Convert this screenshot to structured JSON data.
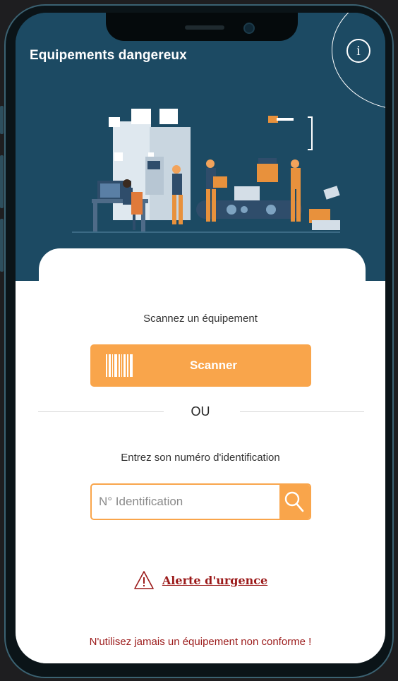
{
  "app": {
    "title": "Equipements dangereux",
    "info_button_label": "i"
  },
  "scan": {
    "prompt": "Scannez un équipement",
    "button_label": "Scanner"
  },
  "or_label": "OU",
  "identification": {
    "prompt": "Entrez son numéro d'identification",
    "placeholder": "N° Identification",
    "value": ""
  },
  "alert": {
    "label": "Alerte d'urgence"
  },
  "footer": {
    "warning": "N'utilisez jamais un équipement non conforme !"
  },
  "colors": {
    "header_bg": "#1c4a63",
    "accent": "#f9a54b",
    "alert_red": "#9b1a1a"
  },
  "icons": {
    "info": "info-icon",
    "barcode": "barcode-icon",
    "search": "search-icon",
    "warning": "warning-triangle-icon"
  }
}
